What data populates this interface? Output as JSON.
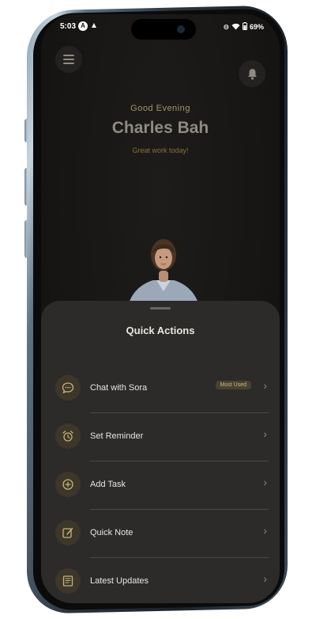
{
  "status_bar": {
    "time": "5:03",
    "battery": "69%"
  },
  "header": {
    "greeting": "Good Evening",
    "user_name": "Charles Bah",
    "subtitle": "Great work today!"
  },
  "sheet": {
    "title": "Quick Actions",
    "items": [
      {
        "label": "Chat with Sora",
        "icon": "chat-icon",
        "badge": "Most Used"
      },
      {
        "label": "Set Reminder",
        "icon": "alarm-clock-icon"
      },
      {
        "label": "Add Task",
        "icon": "add-circle-icon"
      },
      {
        "label": "Quick Note",
        "icon": "edit-note-icon"
      },
      {
        "label": "Latest Updates",
        "icon": "newspaper-icon"
      }
    ]
  },
  "colors": {
    "accent_gold": "#c9b27a",
    "sheet_bg": "#2c2b2a",
    "screen_bg": "#171614"
  }
}
